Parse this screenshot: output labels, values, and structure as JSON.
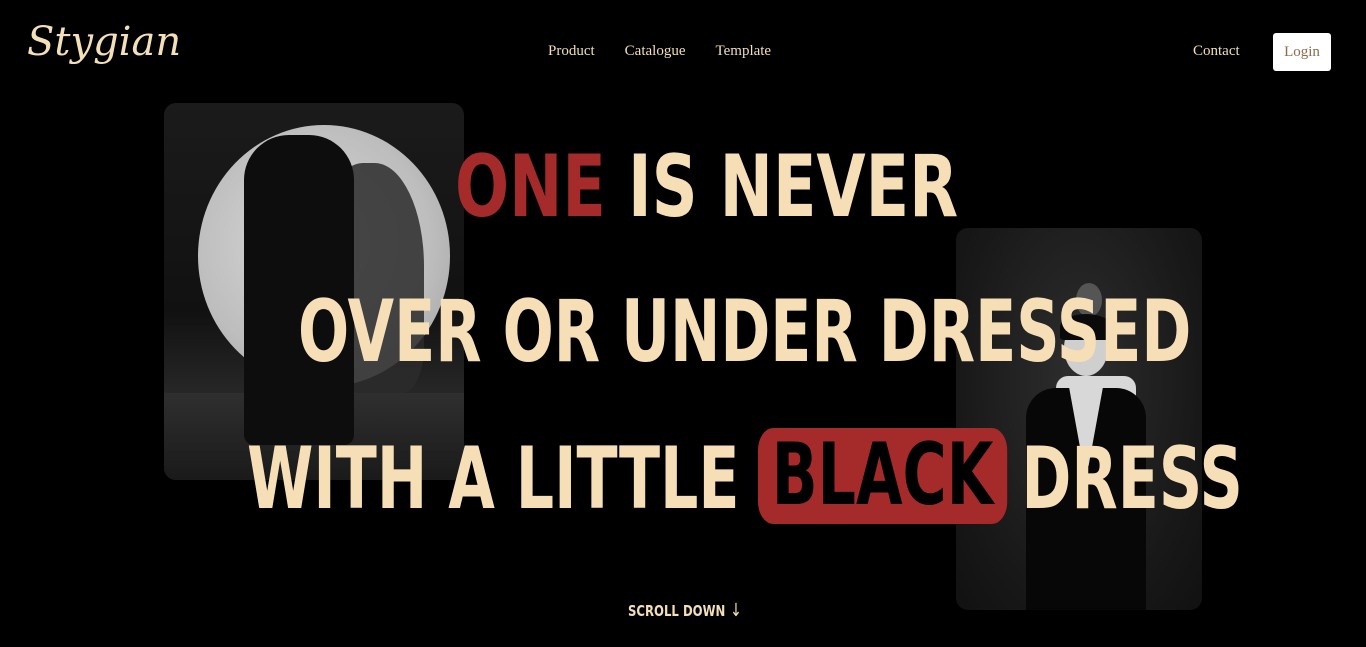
{
  "brand": {
    "logo_text": "Stygian"
  },
  "nav": {
    "items": [
      {
        "label": "Product"
      },
      {
        "label": "Catalogue"
      },
      {
        "label": "Template"
      }
    ],
    "contact_label": "Contact",
    "login_label": "Login"
  },
  "hero": {
    "line1": {
      "accent": "ONE",
      "rest": "IS NEVER"
    },
    "line2": "OVER OR UNDER DRESSED",
    "line3": {
      "before": "WITH A LITTLE",
      "highlight": "BLACK",
      "after": "DRESS"
    },
    "scroll_label": "SCROLL DOWN",
    "scroll_arrow": "↓"
  },
  "images": {
    "left_photo": "woman-on-stool-spotlight-photo",
    "right_photo": "woman-smoking-in-suit-photo"
  },
  "colors": {
    "background": "#000000",
    "cream": "#f6dfb7",
    "accent_red": "#a52a2a",
    "login_bg": "#ffffff"
  }
}
